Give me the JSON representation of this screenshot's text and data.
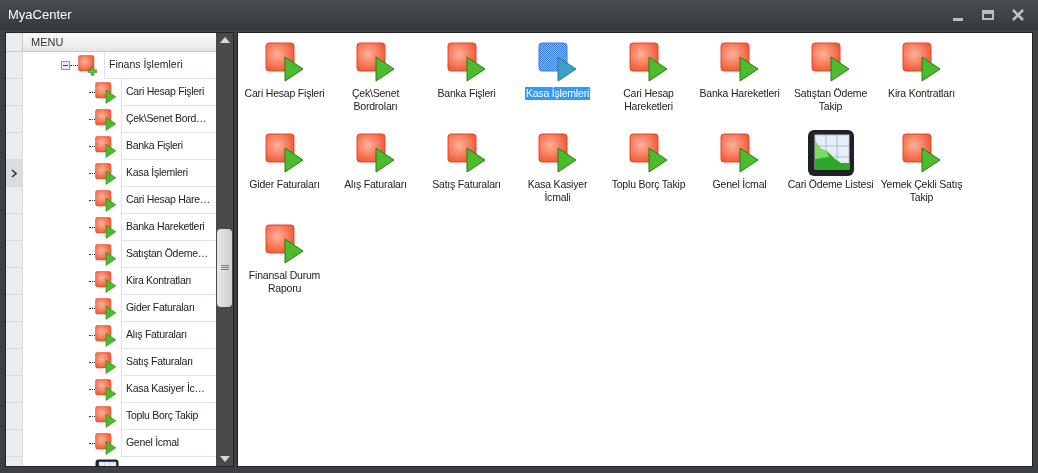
{
  "window": {
    "title": "MyaCenter"
  },
  "tree": {
    "header": "MENU",
    "root": {
      "label": "Finans İşlemleri",
      "expanded": true,
      "children": [
        {
          "label": "Cari Hesap Fişleri",
          "kind": "form",
          "selected": false
        },
        {
          "label": "Çek\\Senet Bord…",
          "kind": "form",
          "selected": false
        },
        {
          "label": "Banka Fişleri",
          "kind": "form",
          "selected": false
        },
        {
          "label": "Kasa İşlemleri",
          "kind": "form",
          "selected": true
        },
        {
          "label": "Cari Hesap Hare…",
          "kind": "form",
          "selected": false
        },
        {
          "label": "Banka Hareketleri",
          "kind": "form",
          "selected": false
        },
        {
          "label": "Satıştan Ödeme…",
          "kind": "form",
          "selected": false
        },
        {
          "label": "Kira Kontratları",
          "kind": "form",
          "selected": false
        },
        {
          "label": "Gider Faturaları",
          "kind": "form",
          "selected": false
        },
        {
          "label": "Alış Faturaları",
          "kind": "form",
          "selected": false
        },
        {
          "label": "Satış Faturaları",
          "kind": "form",
          "selected": false
        },
        {
          "label": "Kasa Kasiyer İc…",
          "kind": "form",
          "selected": false
        },
        {
          "label": "Toplu Borç Takip",
          "kind": "form",
          "selected": false
        },
        {
          "label": "Genel İcmal",
          "kind": "form",
          "selected": false
        },
        {
          "kind": "chart",
          "selected": false
        }
      ]
    }
  },
  "items": [
    {
      "label": "Cari Hesap Fişleri",
      "kind": "form",
      "selected": false
    },
    {
      "label": "Çek\\Senet Bordroları",
      "kind": "form",
      "selected": false
    },
    {
      "label": "Banka Fişleri",
      "kind": "form",
      "selected": false
    },
    {
      "label": "Kasa İşlemleri",
      "kind": "form",
      "selected": true
    },
    {
      "label": "Cari Hesap Hareketleri",
      "kind": "form",
      "selected": false
    },
    {
      "label": "Banka Hareketleri",
      "kind": "form",
      "selected": false
    },
    {
      "label": "Satıştan Ödeme Takip",
      "kind": "form",
      "selected": false
    },
    {
      "label": "Kira Kontratları",
      "kind": "form",
      "selected": false
    },
    {
      "label": "Gider Faturaları",
      "kind": "form",
      "selected": false
    },
    {
      "label": "Alış Faturaları",
      "kind": "form",
      "selected": false
    },
    {
      "label": "Satış Faturaları",
      "kind": "form",
      "selected": false
    },
    {
      "label": "Kasa Kasiyer İcmali",
      "kind": "form",
      "selected": false
    },
    {
      "label": "Toplu Borç Takip",
      "kind": "form",
      "selected": false
    },
    {
      "label": "Genel İcmal",
      "kind": "form",
      "selected": false
    },
    {
      "label": "Cari Ödeme Listesi",
      "kind": "chart",
      "selected": false
    },
    {
      "label": "Yemek Çekli Satış Takip",
      "kind": "form",
      "selected": false
    },
    {
      "label": "Finansal Durum Raporu",
      "kind": "form",
      "selected": false
    }
  ]
}
